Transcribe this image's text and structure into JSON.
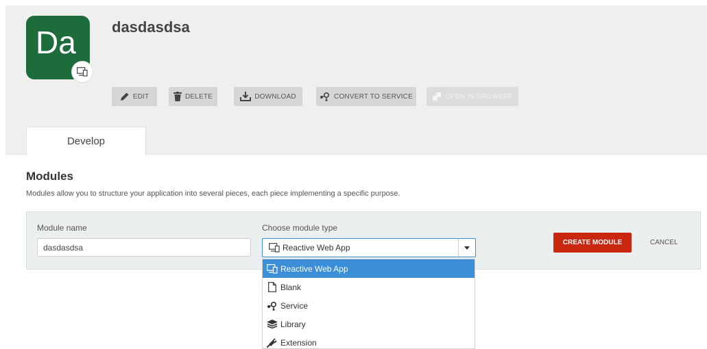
{
  "app": {
    "icon_text": "Da",
    "title": "dasdasdsa"
  },
  "toolbar": {
    "edit": "EDIT",
    "delete": "DELETE",
    "download": "DOWNLOAD",
    "convert": "CONVERT TO SERVICE",
    "open_in_browser": "OPEN IN BROWSER"
  },
  "tabs": [
    {
      "label": "Develop",
      "active": true
    }
  ],
  "modules": {
    "title": "Modules",
    "description": "Modules allow you to structure your application into several pieces, each piece implementing a specific purpose."
  },
  "form": {
    "module_name_label": "Module name",
    "module_name_value": "dasdasdsa",
    "module_type_label": "Choose module type",
    "module_type_selected": "Reactive Web App",
    "create_button": "CREATE MODULE",
    "cancel_button": "CANCEL"
  },
  "dropdown": {
    "options": [
      {
        "label": "Reactive Web App",
        "icon": "devices-icon",
        "selected": true
      },
      {
        "label": "Blank",
        "icon": "file-icon",
        "selected": false
      },
      {
        "label": "Service",
        "icon": "service-icon",
        "selected": false
      },
      {
        "label": "Library",
        "icon": "layers-icon",
        "selected": false
      },
      {
        "label": "Extension",
        "icon": "plug-icon",
        "selected": false
      }
    ]
  },
  "colors": {
    "app_icon_bg": "#1e6b3c",
    "primary_button": "#c9270f",
    "selection": "#3b8fd9"
  }
}
